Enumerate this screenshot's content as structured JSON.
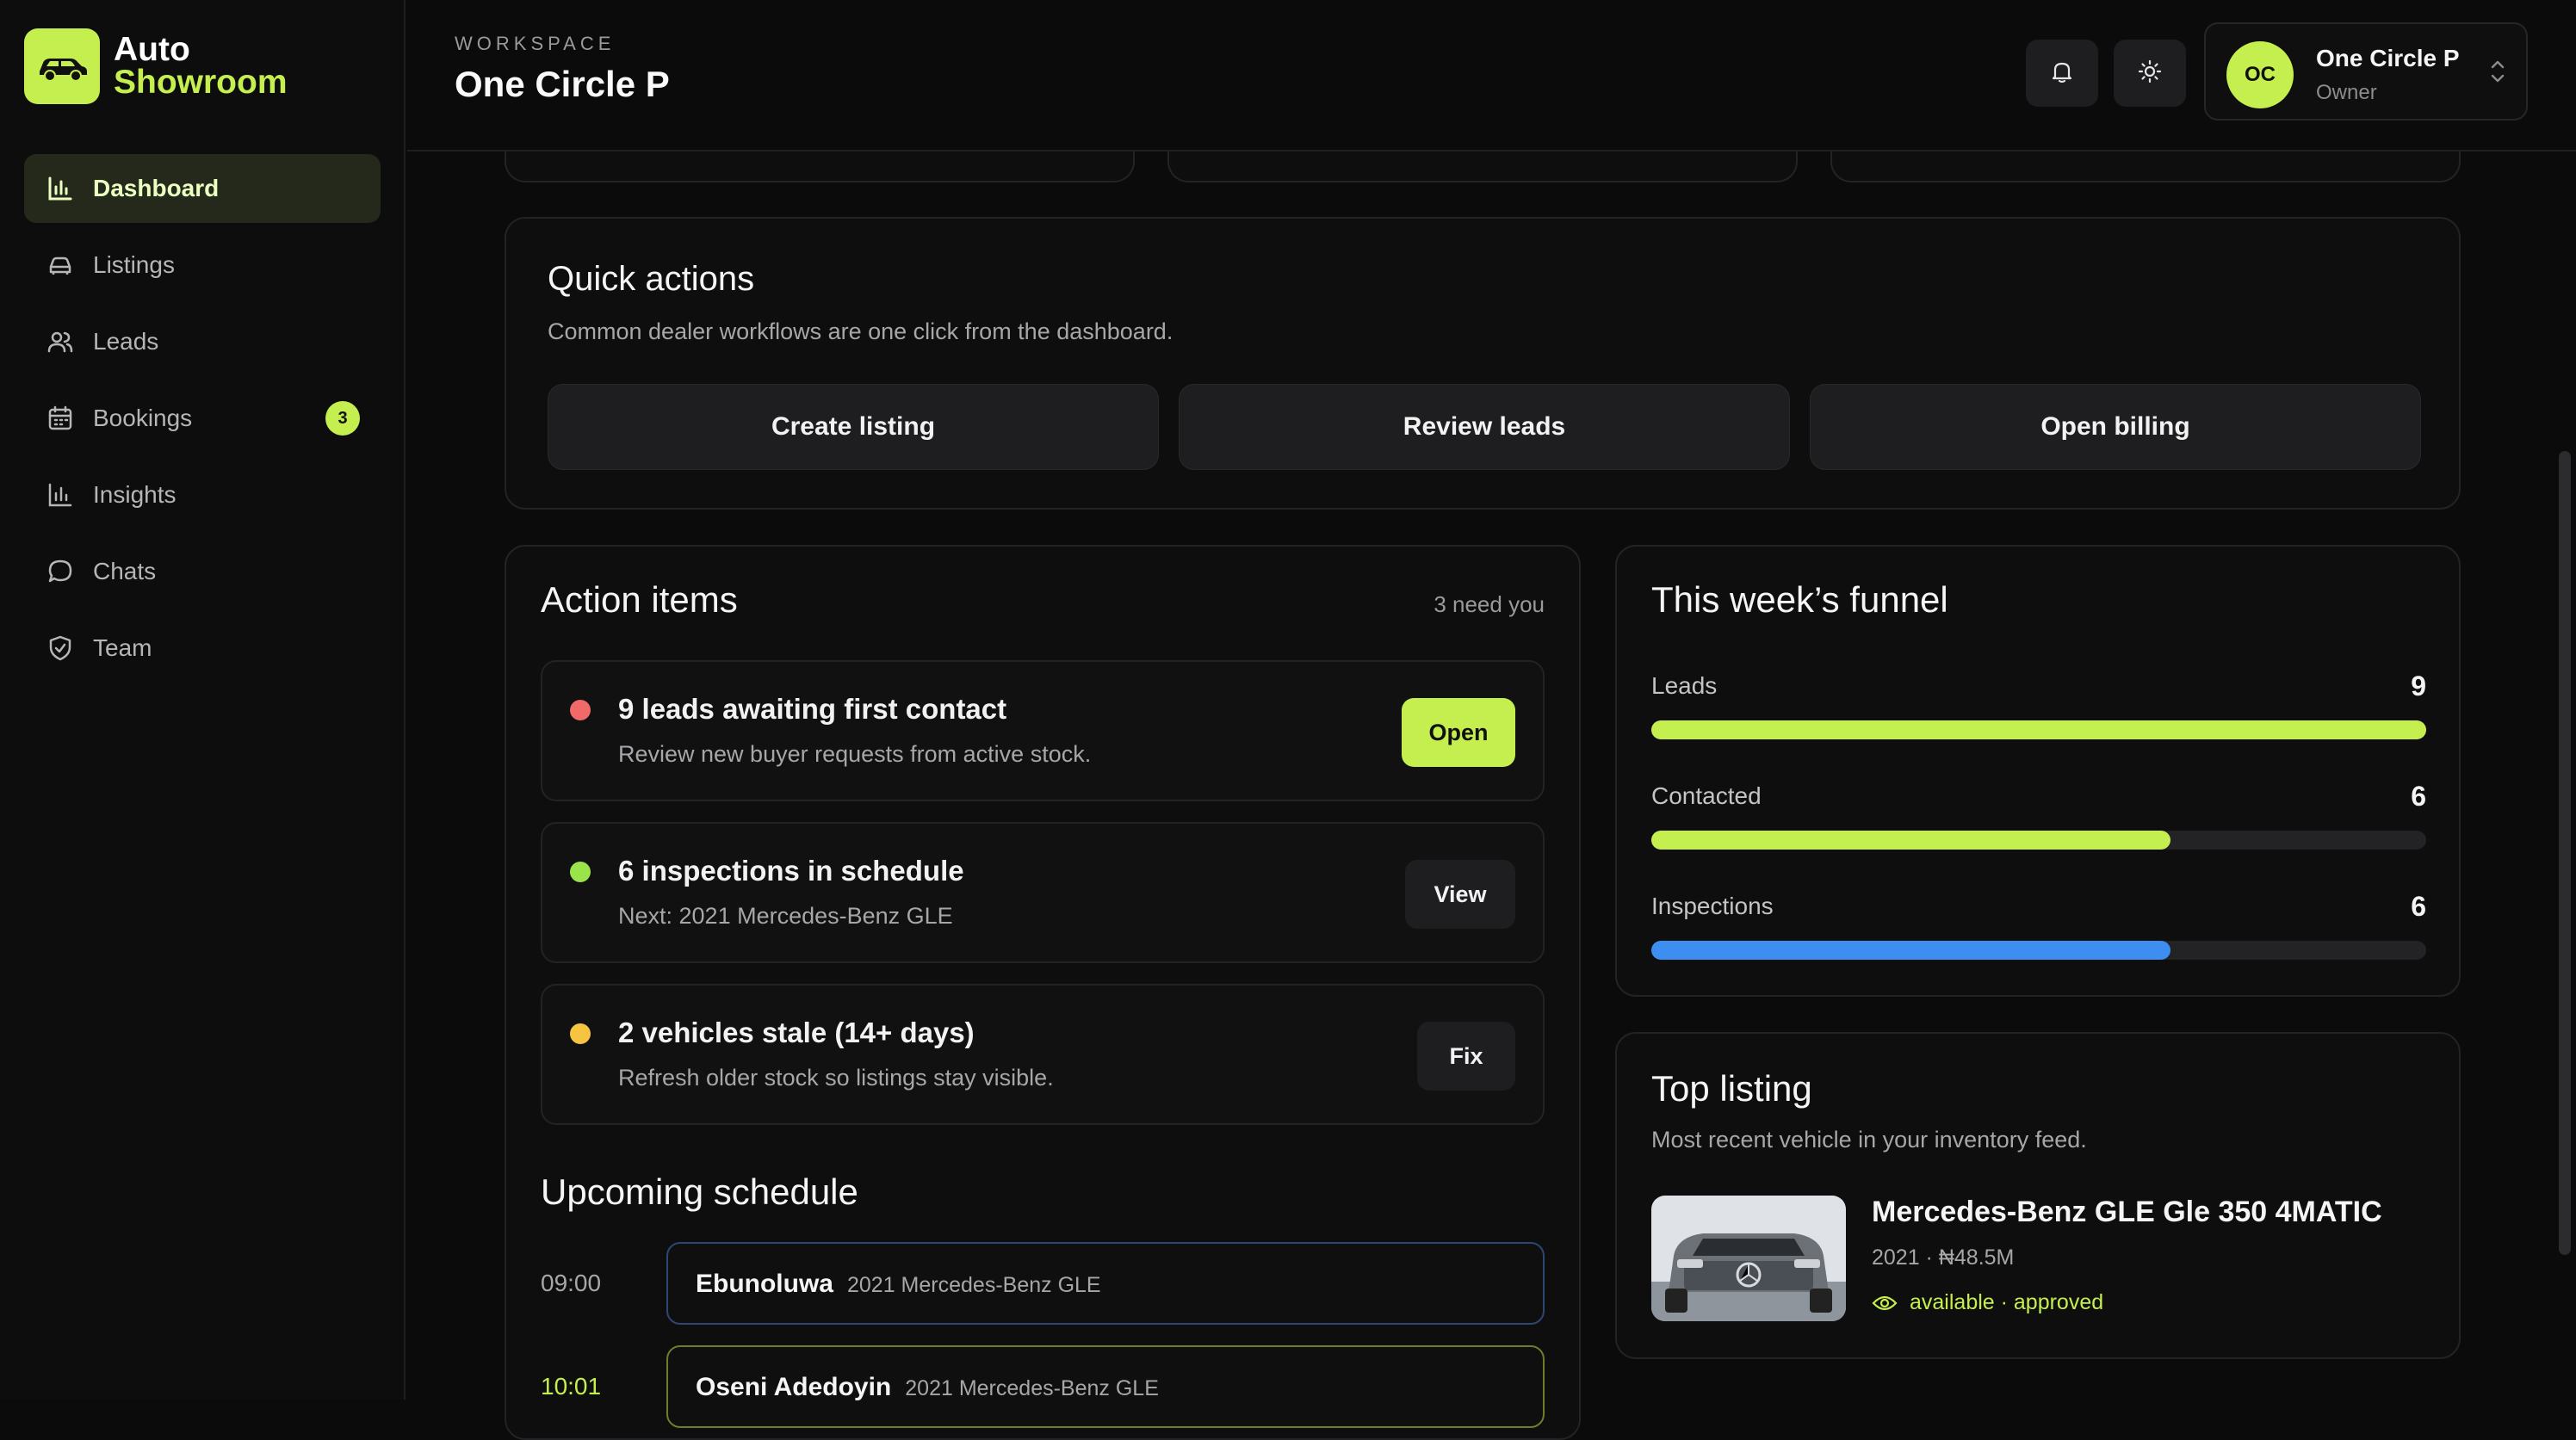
{
  "app": {
    "logo_line1": "Auto",
    "logo_line2": "Showroom",
    "accent_color": "#c4ef4f"
  },
  "sidebar": {
    "items": [
      {
        "label": "Dashboard",
        "icon": "bar-chart-icon",
        "active": true
      },
      {
        "label": "Listings",
        "icon": "car-icon"
      },
      {
        "label": "Leads",
        "icon": "users-icon"
      },
      {
        "label": "Bookings",
        "icon": "calendar-icon",
        "badge": "3"
      },
      {
        "label": "Insights",
        "icon": "bar-chart-icon"
      },
      {
        "label": "Chats",
        "icon": "chat-bubble-icon"
      },
      {
        "label": "Team",
        "icon": "shield-check-icon"
      }
    ]
  },
  "header": {
    "workspace_label": "WORKSPACE",
    "workspace_name": "One Circle P",
    "notifications_icon": "bell-icon",
    "theme_icon": "sun-icon",
    "user": {
      "initials": "OC",
      "name": "One Circle P",
      "role": "Owner"
    }
  },
  "quick_actions": {
    "title": "Quick actions",
    "subtitle": "Common dealer workflows are one click from the dashboard.",
    "buttons": [
      "Create listing",
      "Review leads",
      "Open billing"
    ]
  },
  "action_items": {
    "title": "Action items",
    "count_label": "3 need you",
    "items": [
      {
        "title": "9 leads awaiting first contact",
        "subtitle": "Review new buyer requests from active stock.",
        "button": "Open",
        "dot_color": "#f06a6a"
      },
      {
        "title": "6 inspections in schedule",
        "subtitle": "Next: 2021 Mercedes-Benz GLE",
        "button": "View",
        "dot_color": "#9be34b"
      },
      {
        "title": "2 vehicles stale (14+ days)",
        "subtitle": "Refresh older stock so listings stay visible.",
        "button": "Fix",
        "dot_color": "#f5c542"
      }
    ]
  },
  "schedule": {
    "title": "Upcoming schedule",
    "entries": [
      {
        "time": "09:00",
        "name": "Ebunoluwa",
        "vehicle": "2021 Mercedes-Benz GLE",
        "border_color": "#2d4870"
      },
      {
        "time": "10:01",
        "name": "Oseni Adedoyin",
        "vehicle": "2021 Mercedes-Benz GLE",
        "border_color": "#6e7d2a"
      }
    ]
  },
  "funnel": {
    "title": "This week’s funnel",
    "rows": [
      {
        "label": "Leads",
        "value": 9,
        "fraction": 1.0,
        "color": "#c4ef4f"
      },
      {
        "label": "Contacted",
        "value": 6,
        "fraction": 0.67,
        "color": "#c4ef4f"
      },
      {
        "label": "Inspections",
        "value": 6,
        "fraction": 0.67,
        "color": "#3d8ef0"
      }
    ]
  },
  "top_listing": {
    "title": "Top listing",
    "subtitle": "Most recent vehicle in your inventory feed.",
    "vehicle_name": "Mercedes-Benz GLE Gle 350 4MATIC",
    "meta": "2021 · ₦48.5M",
    "status": "available · approved",
    "status_icon": "eye-icon"
  }
}
